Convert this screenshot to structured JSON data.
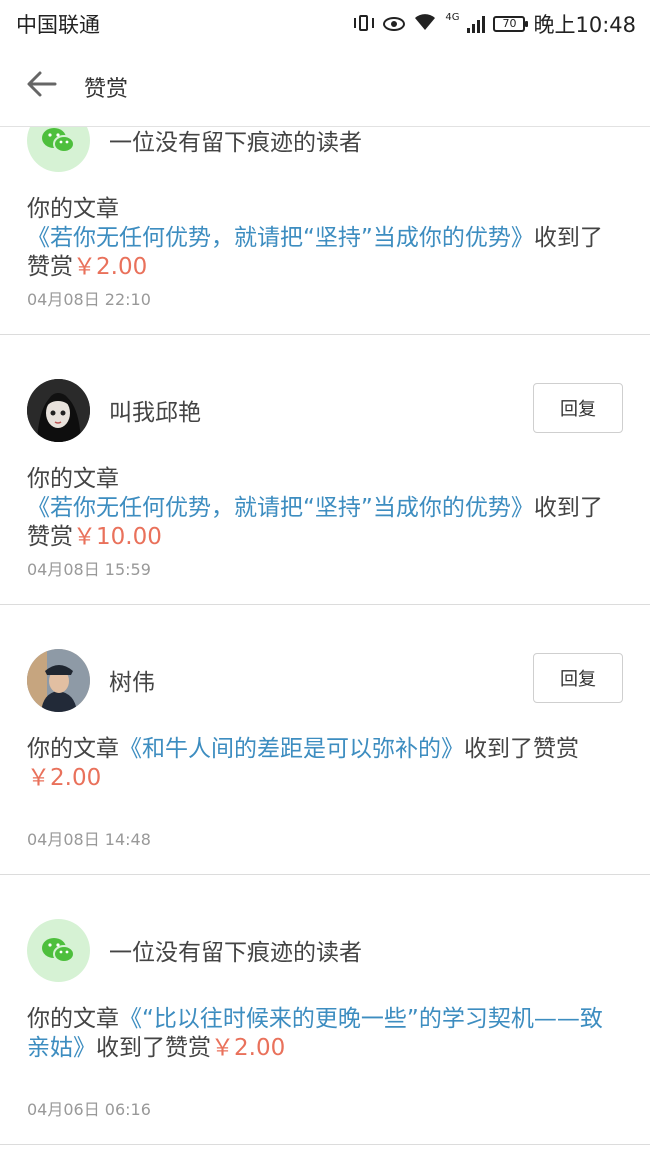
{
  "status_bar": {
    "carrier": "中国联通",
    "network": "4G",
    "battery": "70",
    "time": "晚上10:48"
  },
  "header": {
    "back_icon": "arrow-left-icon",
    "title": "赞赏"
  },
  "rewards": [
    {
      "avatar": "wechat-icon",
      "name": "一位没有留下痕迹的读者",
      "has_reply": false,
      "prefix": "你的文章",
      "article": "《若你无任何优势，就请把“坚持”当成你的优势》",
      "suffix": "收到了赞赏",
      "amount": "￥2.00",
      "time": "04月08日 22:10"
    },
    {
      "avatar": "user-avatar",
      "name": "叫我邱艳",
      "has_reply": true,
      "reply_label": "回复",
      "prefix": "你的文章",
      "article": "《若你无任何优势，就请把“坚持”当成你的优势》",
      "suffix": "收到了赞赏",
      "amount": "￥10.00",
      "time": "04月08日 15:59"
    },
    {
      "avatar": "user-avatar",
      "name": "树伟",
      "has_reply": true,
      "reply_label": "回复",
      "prefix": "你的文章",
      "article": "《和牛人间的差距是可以弥补的》",
      "suffix": "收到了赞赏",
      "amount": "￥2.00",
      "time": "04月08日 14:48"
    },
    {
      "avatar": "wechat-icon",
      "name": "一位没有留下痕迹的读者",
      "has_reply": false,
      "prefix": "你的文章",
      "article": "《“比以往时候来的更晚一些”的学习契机——致亲姑》",
      "suffix": "收到了赞赏",
      "amount": "￥2.00",
      "time": "04月06日 06:16"
    }
  ]
}
